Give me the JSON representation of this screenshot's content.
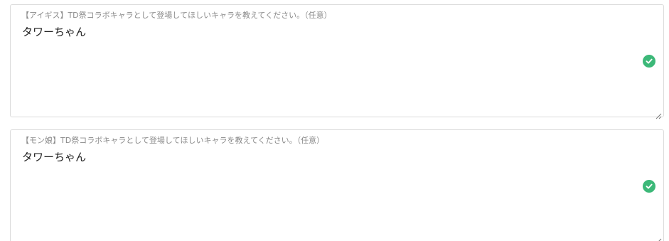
{
  "fields": [
    {
      "label": "【アイギス】TD祭コラボキャラとして登場してほしいキャラを教えてください。（任意）",
      "value": "タワーちゃん",
      "status_icon": "check-circle-icon",
      "status_color": "#3cb878"
    },
    {
      "label": "【モン娘】TD祭コラボキャラとして登場してほしいキャラを教えてください。（任意）",
      "value": "タワーちゃん",
      "status_icon": "check-circle-icon",
      "status_color": "#3cb878"
    }
  ]
}
